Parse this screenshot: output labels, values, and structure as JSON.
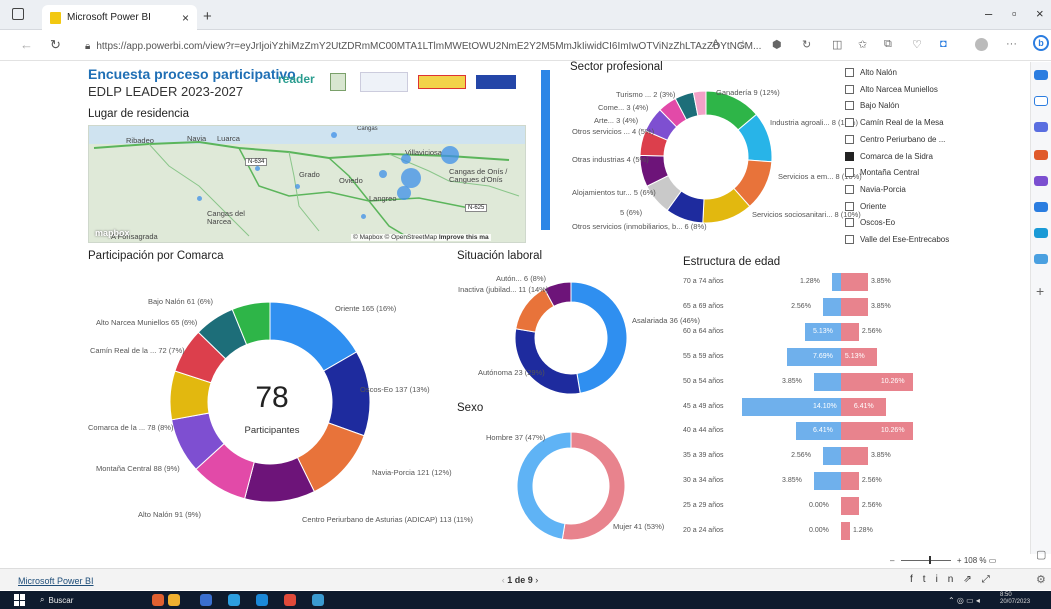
{
  "browser": {
    "tab_title": "Microsoft Power BI",
    "url": "https://app.powerbi.com/view?r=eyJrIjoiYzhiMzZmY2UtZDRmMC00MTA1LTlmMWEtOWU2NmE2Y2M5MmJkIiwidCI6ImIwOTViNzZhLTAzZDYtNGM...",
    "zoom": "108 %"
  },
  "report": {
    "title": "Encuesta proceso participativo",
    "subtitle": "EDLP LEADER 2023-2027",
    "logo_text": "reader",
    "sections": {
      "residence": "Lugar de residencia",
      "comarca": "Participación por Comarca",
      "sector": "Sector profesional",
      "laboral": "Situación laboral",
      "sexo": "Sexo",
      "edad": "Estructura de edad"
    },
    "big_number": "78",
    "big_label": "Participantes"
  },
  "map": {
    "towns": [
      "Ribadeo",
      "Navia",
      "Luarca",
      "Cangas del Narcea",
      "Grado",
      "Oviedo",
      "Langreo",
      "Villaviciosa",
      "Cangas de Onís / Cangues d'Onís",
      "A Fonsagrada",
      "Cangas"
    ],
    "roads": [
      "N-634",
      "N-625"
    ],
    "attribution": "© Mapbox © OpenStreetMap",
    "improve": "Improve this ma"
  },
  "legend": {
    "items": [
      {
        "label": "Alto Nalón",
        "checked": false
      },
      {
        "label": "Alto Narcea Muniellos",
        "checked": false
      },
      {
        "label": "Bajo Nalón",
        "checked": false
      },
      {
        "label": "Camín Real de la Mesa",
        "checked": false
      },
      {
        "label": "Centro Periurbano de ...",
        "checked": false
      },
      {
        "label": "Comarca de la Sidra",
        "checked": true
      },
      {
        "label": "Montaña Central",
        "checked": false
      },
      {
        "label": "Navia-Porcia",
        "checked": false
      },
      {
        "label": "Oriente",
        "checked": false
      },
      {
        "label": "Oscos-Eo",
        "checked": false
      },
      {
        "label": "Valle del Ese-Entrecabos",
        "checked": false
      }
    ]
  },
  "status": {
    "pbi_link": "Microsoft Power BI",
    "pager": "1 de 9",
    "search": "Buscar"
  },
  "chart_data": [
    {
      "type": "pie",
      "title": "Participación por Comarca",
      "center_value": "78",
      "center_label": "Participantes",
      "slices": [
        {
          "label": "Oriente",
          "value": 165,
          "pct": "16%",
          "color": "#2f8ff0"
        },
        {
          "label": "Oscos-Eo",
          "value": 137,
          "pct": "13%",
          "color": "#1e2b9e"
        },
        {
          "label": "Navia-Porcia",
          "value": 121,
          "pct": "12%",
          "color": "#e8733a"
        },
        {
          "label": "Centro Periurbano de Asturias (ADICAP)",
          "value": 113,
          "pct": "11%",
          "color": "#6d1479"
        },
        {
          "label": "Alto Nalón",
          "value": 91,
          "pct": "9%",
          "color": "#e24aa8"
        },
        {
          "label": "Montaña Central",
          "value": 88,
          "pct": "9%",
          "color": "#7e4fd1"
        },
        {
          "label": "Comarca de la ...",
          "value": 78,
          "pct": "8%",
          "color": "#e2b80f"
        },
        {
          "label": "Camín Real de la ...",
          "value": 72,
          "pct": "7%",
          "color": "#dc3f4c"
        },
        {
          "label": "Alto Narcea Muniellos",
          "value": 65,
          "pct": "6%",
          "color": "#1d6e79"
        },
        {
          "label": "Bajo Nalón",
          "value": 61,
          "pct": "6%",
          "color": "#2eb548"
        }
      ]
    },
    {
      "type": "pie",
      "title": "Sector profesional",
      "slices": [
        {
          "label": "Ganadería",
          "value": 9,
          "pct": "12%",
          "color": "#2eb548"
        },
        {
          "label": "Industria agroali...",
          "value": 8,
          "pct": "10%",
          "color": "#28b4e8"
        },
        {
          "label": "Servicios a em...",
          "value": 8,
          "pct": "10%",
          "color": "#e8733a"
        },
        {
          "label": "Servicios sociosanitari...",
          "value": 8,
          "pct": "10%",
          "color": "#e2b80f"
        },
        {
          "label": "Otros servicios (inmobiliarios, b...",
          "value": 6,
          "pct": "8%",
          "color": "#1e2b9e"
        },
        {
          "label": "",
          "value": 5,
          "pct": "6%",
          "color": "#c9c9c9"
        },
        {
          "label": "Alojamientos tur...",
          "value": 5,
          "pct": "6%",
          "color": "#6d1479"
        },
        {
          "label": "Otras industrias",
          "value": 4,
          "pct": "5%",
          "color": "#dc3f4c"
        },
        {
          "label": "Otros servicios ...",
          "value": 4,
          "pct": "5%",
          "color": "#7e4fd1"
        },
        {
          "label": "Arte...",
          "value": 3,
          "pct": "4%",
          "color": "#e24aa8"
        },
        {
          "label": "Come...",
          "value": 3,
          "pct": "4%",
          "color": "#1d6e79"
        },
        {
          "label": "Turismo ...",
          "value": 2,
          "pct": "3%",
          "color": "#f2a1c7"
        }
      ]
    },
    {
      "type": "pie",
      "title": "Situación laboral",
      "slices": [
        {
          "label": "Asalariada",
          "value": 36,
          "pct": "46%",
          "color": "#2f8ff0"
        },
        {
          "label": "Autónoma",
          "value": 23,
          "pct": "29%",
          "color": "#1e2b9e"
        },
        {
          "label": "Inactiva (jubilad...",
          "value": 11,
          "pct": "14%",
          "color": "#e8733a"
        },
        {
          "label": "Autón...",
          "value": 6,
          "pct": "8%",
          "color": "#6d1479"
        }
      ]
    },
    {
      "type": "pie",
      "title": "Sexo",
      "slices": [
        {
          "label": "Mujer",
          "value": 41,
          "pct": "53%",
          "color": "#e8838d"
        },
        {
          "label": "Hombre",
          "value": 37,
          "pct": "47%",
          "color": "#5fb3f5"
        }
      ]
    },
    {
      "type": "bar",
      "title": "Estructura de edad",
      "categories": [
        "70 a 74 años",
        "65 a 69 años",
        "60 a 64 años",
        "55 a 59 años",
        "50 a 54 años",
        "45 a 49 años",
        "40 a 44 años",
        "35 a 39 años",
        "30 a 34 años",
        "25 a 29 años",
        "20 a 24 años"
      ],
      "series": [
        {
          "values": [
            1.28,
            2.56,
            5.13,
            7.69,
            3.85,
            14.1,
            6.41,
            2.56,
            3.85,
            0.0,
            0.0
          ],
          "labels": [
            "1.28%",
            "2.56%",
            "5.13%",
            "7.69%",
            "3.85%",
            "14.10%",
            "6.41%",
            "2.56%",
            "3.85%",
            "0.00%",
            "0.00%"
          ],
          "color": "#6fb0ec"
        },
        {
          "values": [
            3.85,
            3.85,
            2.56,
            5.13,
            10.26,
            6.41,
            10.26,
            3.85,
            2.56,
            2.56,
            1.28
          ],
          "labels": [
            "3.85%",
            "3.85%",
            "2.56%",
            "5.13%",
            "10.26%",
            "6.41%",
            "10.26%",
            "3.85%",
            "2.56%",
            "2.56%",
            "1.28%"
          ],
          "color": "#e8838d"
        }
      ]
    }
  ]
}
